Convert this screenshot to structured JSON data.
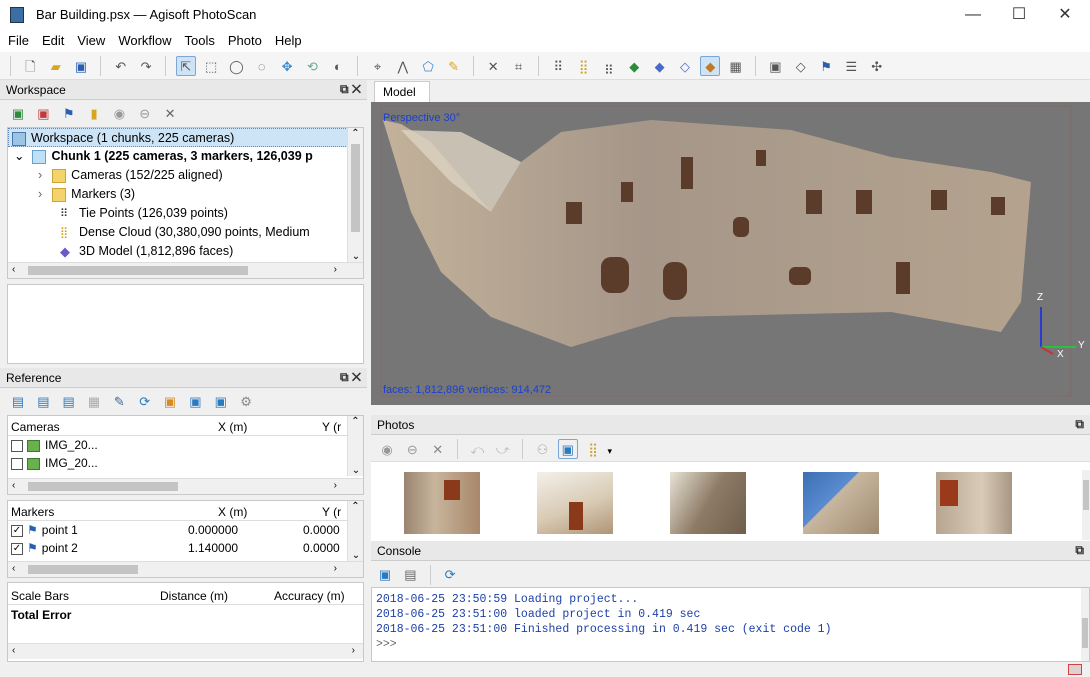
{
  "app": {
    "title": "Bar Building.psx — Agisoft PhotoScan",
    "minimize": "—",
    "maximize": "☐",
    "close": "✕"
  },
  "menu": [
    "File",
    "Edit",
    "View",
    "Workflow",
    "Tools",
    "Photo",
    "Help"
  ],
  "workspace": {
    "title": "Workspace",
    "ctrls": "⧉ ✕",
    "root": "Workspace (1 chunks, 225 cameras)",
    "chunk": "Chunk 1 (225 cameras, 3 markers, 126,039 p",
    "items": [
      {
        "label": "Cameras (152/225 aligned)",
        "icon": "folder-icon"
      },
      {
        "label": "Markers (3)",
        "icon": "folder-icon"
      },
      {
        "label": "Tie Points (126,039 points)",
        "icon": "tie-points-icon"
      },
      {
        "label": "Dense Cloud (30,380,090 points, Medium",
        "icon": "dense-cloud-icon"
      },
      {
        "label": "3D Model (1,812,896 faces)",
        "icon": "model-icon"
      }
    ]
  },
  "reference": {
    "title": "Reference",
    "ctrls": "⧉ ✕",
    "cameras_header": {
      "name": "Cameras",
      "x": "X (m)",
      "y": "Y (r"
    },
    "cameras": [
      "IMG_20...",
      "IMG_20..."
    ],
    "markers_header": {
      "name": "Markers",
      "x": "X (m)",
      "y": "Y (r"
    },
    "markers": [
      {
        "name": "point 1",
        "x": "0.000000",
        "y": "0.0000"
      },
      {
        "name": "point 2",
        "x": "1.140000",
        "y": "0.0000"
      }
    ],
    "scalebars_header": {
      "name": "Scale Bars",
      "distance": "Distance (m)",
      "accuracy": "Accuracy (m)"
    },
    "total_error": "Total Error"
  },
  "model": {
    "tab": "Model",
    "perspective": "Perspective 30°",
    "stats": "faces: 1,812,896 vertices: 914,472",
    "axis_z": "Z",
    "axis_y": "Y",
    "axis_x": "X"
  },
  "photos": {
    "title": "Photos",
    "ctrl": "⧉"
  },
  "console": {
    "title": "Console",
    "ctrl": "⧉",
    "lines": [
      "2018-06-25 23:50:59 Loading project...",
      "2018-06-25 23:51:00 loaded project in 0.419 sec",
      "2018-06-25 23:51:00 Finished processing in 0.419 sec (exit code 1)",
      ">>>"
    ]
  }
}
